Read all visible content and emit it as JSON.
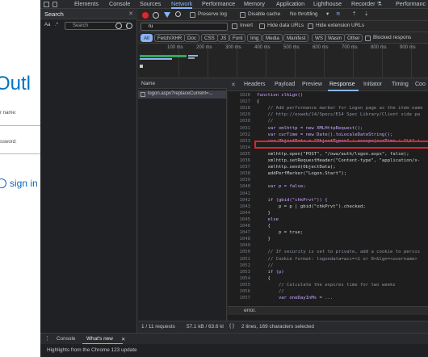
{
  "page": {
    "brand": "Outl",
    "user_label": "r name:",
    "password_label": "ssword:",
    "signin": "sign in"
  },
  "devtools": {
    "tabs": [
      "Elements",
      "Console",
      "Sources",
      "Network",
      "Performance",
      "Memory",
      "Application",
      "Lighthouse",
      "Recorder ⚗",
      "Performanc"
    ],
    "active_tab": "Network",
    "search": {
      "title": "Search",
      "aa": "Aa",
      "dotstar": ".*",
      "placeholder": "Search"
    },
    "toolbar": {
      "preserve_log": "Preserve log",
      "disable_cache": "Disable cache",
      "throttling": "No throttling"
    },
    "filter": {
      "value": "ru",
      "invert": "Invert",
      "hide_data_urls": "Hide data URLs",
      "hide_extension_urls": "Hide extension URLs"
    },
    "types": [
      "All",
      "Fetch/XHR",
      "Doc",
      "CSS",
      "JS",
      "Font",
      "Img",
      "Media",
      "Manifest",
      "WS",
      "Wasm",
      "Other"
    ],
    "blocked_responses": "Blocked respons",
    "timeline_ticks": [
      "100 ms",
      "200 ms",
      "300 ms",
      "400 ms",
      "500 ms",
      "600 ms",
      "700 ms",
      "800 ms",
      "900 ms",
      "1000 ms"
    ],
    "requests": {
      "header_name": "Name",
      "items": [
        "logon.aspx?replaceCurrent=..."
      ]
    },
    "detail_tabs": [
      "Headers",
      "Payload",
      "Preview",
      "Response",
      "Initiator",
      "Timing",
      "Coo"
    ],
    "active_detail_tab": "Response",
    "code": {
      "lines": [
        {
          "n": "1026",
          "t": "function clkLgn()"
        },
        {
          "n": "1027",
          "t": "{"
        },
        {
          "n": "1028",
          "t": "    // Add performance marker for Logon page as the item name"
        },
        {
          "n": "1029",
          "t": "    // http://exweb/14/Specs/E14 Spec Library/Client side pa"
        },
        {
          "n": "1030",
          "t": "    //"
        },
        {
          "n": "1031",
          "t": "    var xmlhttp = new XMLHttpRequest();"
        },
        {
          "n": "1032",
          "t": "    var curTime = new Date().toLocaleDateString();"
        },
        {
          "n": "1033",
          "t": "    var ObjectData = \"ObjectType=\" + escape(curTime + \"\\t\" +"
        },
        {
          "n": "1034",
          "t": ""
        },
        {
          "n": "1035",
          "t": "    xmlhttp.open(\"POST\", \"/owa/auth/logon.aspx\", false);"
        },
        {
          "n": "1036",
          "t": "    xmlhttp.setRequestHeader(\"Content-type\", \"application/x-"
        },
        {
          "n": "1037",
          "t": "    xmlhttp.send(ObjectData);"
        },
        {
          "n": "1038",
          "t": "    addPerfMarker(\"Logon.Start\");"
        },
        {
          "n": "1039",
          "t": ""
        },
        {
          "n": "1040",
          "t": "    var p = false;"
        },
        {
          "n": "1041",
          "t": ""
        },
        {
          "n": "1042",
          "t": "    if (gbid(\"chkPrvt\")) {"
        },
        {
          "n": "1043",
          "t": "        p = p | gbid(\"chkPrvt\").checked;"
        },
        {
          "n": "1044",
          "t": "    }"
        },
        {
          "n": "1045",
          "t": "    else"
        },
        {
          "n": "1046",
          "t": "    {"
        },
        {
          "n": "1047",
          "t": "        p = true;"
        },
        {
          "n": "1048",
          "t": "    }"
        },
        {
          "n": "1049",
          "t": ""
        },
        {
          "n": "1050",
          "t": "    // If security is set to private, add a cookie to persis"
        },
        {
          "n": "1051",
          "t": "    // Cookie format: logondata=acc=<1 or 0>&lgn=<username>"
        },
        {
          "n": "1052",
          "t": "    //"
        },
        {
          "n": "1053",
          "t": "    if (p)"
        },
        {
          "n": "1054",
          "t": "    {"
        },
        {
          "n": "1055",
          "t": "        // Calculate the expires time for two weeks"
        },
        {
          "n": "1056",
          "t": "        //"
        },
        {
          "n": "1057",
          "t": "        var oneDayInMs = ..."
        }
      ],
      "search_value": "error."
    },
    "status": {
      "requests": "1 / 11 requests",
      "transferred": "57.1 kB / 63.6 kl",
      "selection": "2 lines, 169 characters selected"
    },
    "drawer": {
      "tabs": [
        "Console",
        "What's new"
      ],
      "active": "What's new",
      "text": "Highlights from the Chrome 123 update"
    }
  },
  "colors": {
    "accent": "#8ab4f8",
    "highlight_border": "#e0252c",
    "brand": "#0072c6"
  }
}
